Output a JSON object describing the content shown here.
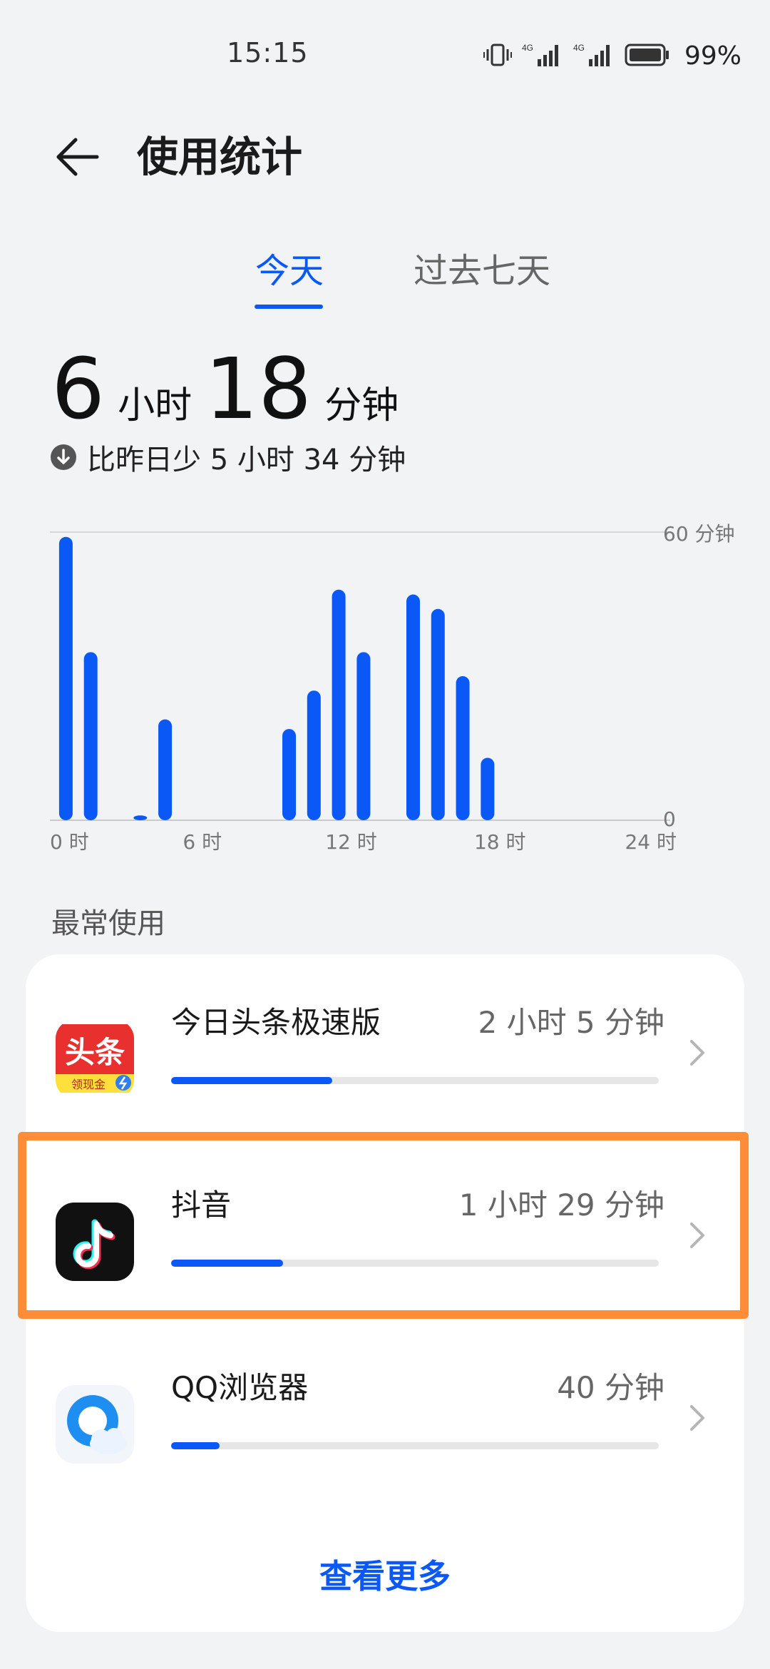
{
  "status_bar": {
    "time": "15:15",
    "network_1": "4G",
    "network_2": "4G",
    "battery": "99%",
    "icons": [
      "vibrate-icon",
      "signal-icon",
      "signal-icon",
      "battery-icon"
    ]
  },
  "header": {
    "title": "使用统计"
  },
  "tabs": [
    {
      "label": "今天",
      "selected": true
    },
    {
      "label": "过去七天",
      "selected": false
    }
  ],
  "total": {
    "hours": "6",
    "hours_unit": "小时",
    "minutes": "18",
    "minutes_unit": "分钟",
    "compare": "比昨日少 5 小时 34 分钟"
  },
  "chart_data": {
    "type": "bar",
    "x": [
      0,
      1,
      2,
      3,
      4,
      5,
      6,
      7,
      8,
      9,
      10,
      11,
      12,
      13,
      14,
      15,
      16,
      17,
      18,
      19,
      20,
      21,
      22,
      23
    ],
    "values": [
      59,
      35,
      0,
      1,
      21,
      0,
      0,
      0,
      0,
      19,
      27,
      48,
      35,
      0,
      47,
      44,
      30,
      13,
      0,
      0,
      0,
      0,
      0,
      0
    ],
    "x_tick_labels": [
      "0 时",
      "6 时",
      "12 时",
      "18 时",
      "24 时"
    ],
    "y_tick_labels": [
      "60 分钟",
      "0"
    ],
    "ylim": [
      0,
      60
    ],
    "grid": "top and bottom horizontal lines",
    "bar_color": "#0a59f7"
  },
  "section": {
    "title": "最常使用"
  },
  "apps": [
    {
      "name": "今日头条极速版",
      "time": "2 小时 5 分钟",
      "usage_fraction": 0.33,
      "icon": "toutiao-icon",
      "icon_text": "头条",
      "icon_sub": "领现金"
    },
    {
      "name": "抖音",
      "time": "1 小时 29 分钟",
      "usage_fraction": 0.23,
      "icon": "douyin-icon"
    },
    {
      "name": "QQ浏览器",
      "time": "40 分钟",
      "usage_fraction": 0.1,
      "icon": "qq-browser-icon"
    }
  ],
  "more_label": "查看更多",
  "colors": {
    "accent": "#0a59f7",
    "highlight": "#ff8c37",
    "background": "#f1f3f5"
  }
}
